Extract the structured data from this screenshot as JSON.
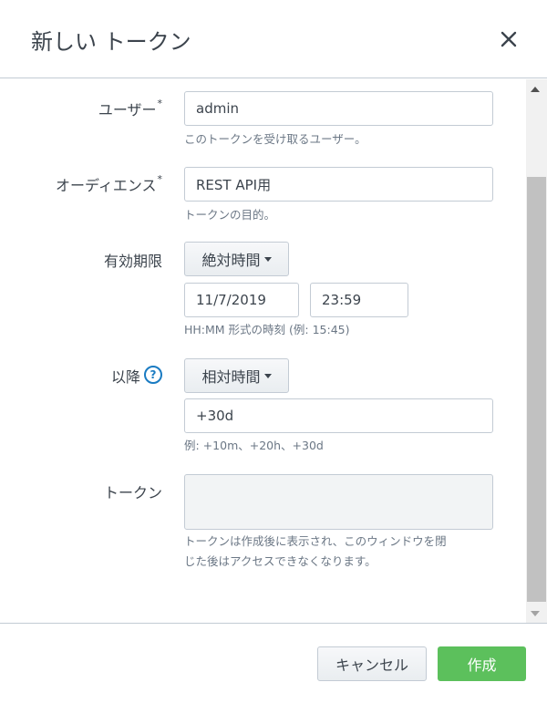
{
  "modal": {
    "title": "新しい トークン",
    "close_icon": "close-icon"
  },
  "form": {
    "user": {
      "label": "ユーザー",
      "required_mark": "*",
      "value": "admin",
      "help": "このトークンを受け取るユーザー。"
    },
    "audience": {
      "label": "オーディエンス",
      "required_mark": "*",
      "value": "REST API用",
      "help": "トークンの目的。"
    },
    "expiration": {
      "label": "有効期限",
      "mode": "絶対時間",
      "date": "11/7/2019",
      "time": "23:59",
      "help": "HH:MM 形式の時刻 (例: 15:45)"
    },
    "not_before": {
      "label": "以降",
      "help_icon": "?",
      "mode": "相対時間",
      "value": "+30d",
      "help": "例: +10m、+20h、+30d"
    },
    "token": {
      "label": "トークン",
      "value": "",
      "help_line1": "トークンは作成後に表示され、このウィンドウを閉",
      "help_line2": "じた後はアクセスできなくなります。"
    }
  },
  "footer": {
    "cancel_label": "キャンセル",
    "create_label": "作成"
  },
  "colors": {
    "accent": "#5cc05c",
    "link": "#1a7bc2",
    "border": "#c3cbd4",
    "text": "#3c444d",
    "muted": "#6b7785"
  }
}
